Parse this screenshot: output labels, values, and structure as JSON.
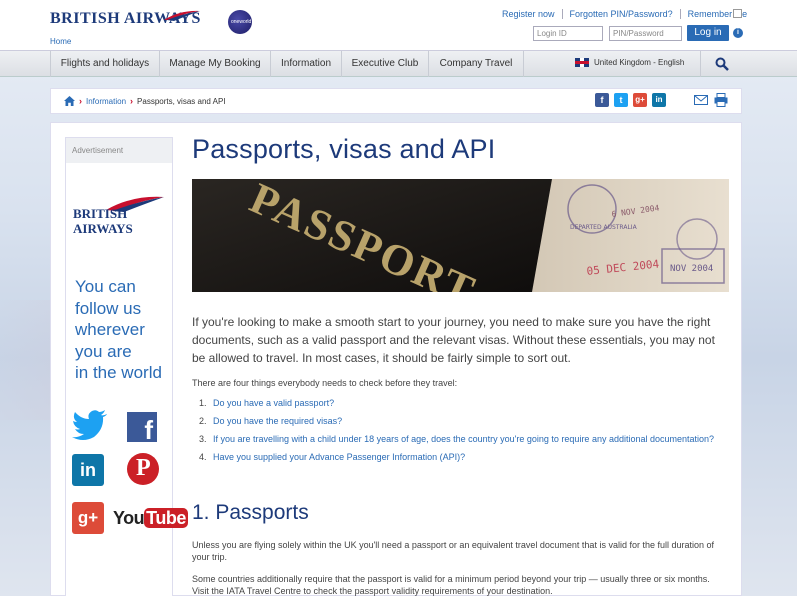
{
  "brand": {
    "name": "BRITISH AIRWAYS",
    "home": "Home",
    "oneworld": "oneworld"
  },
  "toplinks": {
    "register": "Register now",
    "forgot": "Forgotten PIN/Password?",
    "remember": "Remember me"
  },
  "login": {
    "id_placeholder": "Login ID",
    "pin_placeholder": "PIN/Password",
    "button": "Log in",
    "info": "i"
  },
  "nav": {
    "items": [
      "Flights and holidays",
      "Manage My Booking",
      "Information",
      "Executive Club",
      "Company Travel"
    ],
    "locale": "United Kingdom - English"
  },
  "breadcrumb": {
    "parent": "Information",
    "current": "Passports, visas and API"
  },
  "ad": {
    "header": "Advertisement",
    "logo_line1": "BRITISH",
    "logo_line2": "AIRWAYS",
    "tagline": [
      "You can",
      "follow us",
      "wherever",
      "you are",
      "in the world"
    ],
    "youtube_you": "You",
    "youtube_tube": "Tube"
  },
  "main": {
    "title": "Passports, visas and API",
    "hero_text": "PASSPORT",
    "stamp1": "6 NOV 2004",
    "stamp2": "05 DEC 2004",
    "stamp3": "DEPARTED AUSTRALIA",
    "stamp4": "NOV 2004",
    "intro": "If you're looking to make a smooth start to your journey, you need to make sure you have the right documents, such as a valid passport and the relevant visas. Without these essentials, you may not be allowed to travel. In most cases, it should be fairly simple to sort out.",
    "check_intro": "There are four things everybody needs to check before they travel:",
    "checks": [
      "Do you have a valid passport?",
      "Do you have the required visas?",
      "If you are travelling with a child under 18 years of age, does the country you're going to require any additional documentation?",
      "Have you supplied your Advance Passenger Information (API)?"
    ],
    "section1_title": "1. Passports",
    "section1_p1": "Unless you are flying solely within the UK you'll need a passport or an equivalent travel document that is valid for the full duration of your trip.",
    "section1_p2": "Some countries additionally require that the passport is valid for a minimum period beyond your trip — usually three or six months. Visit the IATA Travel Centre to check the passport validity requirements of your destination."
  },
  "colors": {
    "brand_blue": "#1d3a7a",
    "link_blue": "#2a6bb5",
    "brand_red": "#c8102e"
  }
}
